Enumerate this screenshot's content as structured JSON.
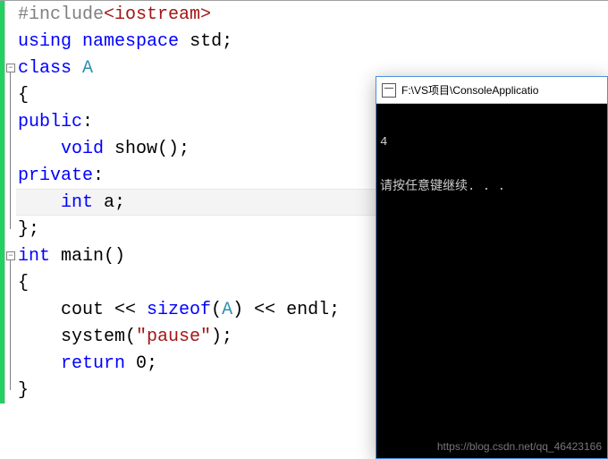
{
  "code": {
    "l1_pp": "#include",
    "l1_inc": "<iostream>",
    "l2_kw1": "using",
    "l2_kw2": "namespace",
    "l2_txt": " std;",
    "l3_kw": "class",
    "l3_typ": " A",
    "l4": "{",
    "l5_kw": "public",
    "l5_txt": ":",
    "l6_indent": "    ",
    "l6_kw": "void",
    "l6_txt": " show();",
    "l7_kw": "private",
    "l7_txt": ":",
    "l8_indent": "    ",
    "l8_kw": "int",
    "l8_txt": " a;",
    "l9": "};",
    "l10_kw": "int",
    "l10_txt": " main()",
    "l11": "{",
    "l12_indent": "    ",
    "l12_txt1": "cout << ",
    "l12_kw": "sizeof",
    "l12_txt2": "(",
    "l12_typ": "A",
    "l12_txt3": ") << endl;",
    "l13_indent": "    ",
    "l13_txt1": "system(",
    "l13_str": "\"pause\"",
    "l13_txt2": ");",
    "l14_indent": "    ",
    "l14_kw": "return",
    "l14_txt": " 0;",
    "l15": "}",
    "outline_collapse": "−"
  },
  "console": {
    "title": "F:\\VS项目\\ConsoleApplicatio",
    "lines": [
      "4",
      "请按任意键继续. . ."
    ]
  },
  "watermark": "https://blog.csdn.net/qq_46423166"
}
